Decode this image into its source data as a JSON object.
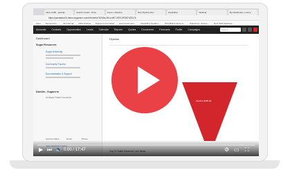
{
  "browser": {
    "tabs": [
      "Inbox (138) - peter@",
      "Search results - Docu",
      "Home » Pipeline",
      "New Pipeline Dev",
      "PandaDoc",
      "Webinar",
      "My Dashboard » Home"
    ],
    "url": "https://pandadoc01.demo.sugarcrm.com/#Home/a71f2d0a-2b1d-dff7-2870-5f7487423176",
    "bookmarks": [
      "Apps",
      "Personal Fo...",
      "SD Internal",
      "CRM Outlook",
      "Passport Committed",
      "www.sunlet.earn...",
      "PandaDoc Sandbo...",
      "SAS Maintenance &...",
      "Salesforce - Enterp...",
      "Best CRM Software..."
    ]
  },
  "nav": {
    "items": [
      "Accounts",
      "Contacts",
      "Opportunities",
      "Leads",
      "Calendar",
      "Reports",
      "Quotes",
      "Documents",
      "Forecasts",
      "Profile",
      "Campaigns"
    ],
    "search_placeholder": "Search"
  },
  "left": {
    "title": "Dashboard",
    "sections": [
      {
        "heading": "Sugar Resources"
      },
      {
        "heading": "Dashlet - Sugarcrm"
      }
    ],
    "links": [
      "Sugar University",
      "Community Forums",
      "Documentation & Support"
    ],
    "config_text": "Configure Twitter Connector",
    "bottom_texts": [
      "Account Name",
      "Email",
      "Phone",
      "Sally Dashboard Setup"
    ]
  },
  "right": {
    "pipeline_title": "Pipeline",
    "funnel_label": "Pipeline $685.00",
    "bottom_label": "Top 10 Sales Revenue Line Items"
  },
  "player": {
    "time": "0:00 / 17:47",
    "play_label": "Play video",
    "progress_fraction": 0.0
  },
  "colors": {
    "play_red": "#e8373d",
    "nav_dark": "#222222",
    "funnel_red": "#d3262c"
  }
}
